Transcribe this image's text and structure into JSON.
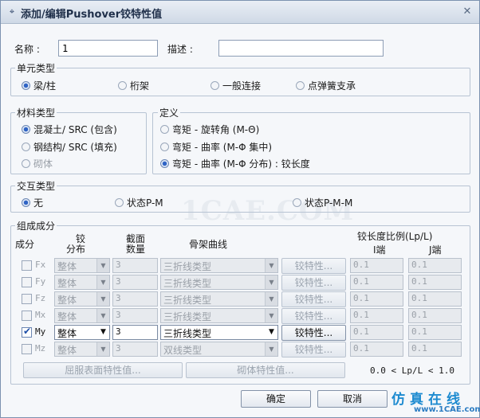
{
  "window": {
    "title": "添加/编辑Pushover铰特性值",
    "close_glyph": "✕",
    "title_glyph": "⌖"
  },
  "name": {
    "label": "名称 :",
    "value": "1"
  },
  "desc": {
    "label": "描述 :",
    "value": ""
  },
  "element_type": {
    "legend": "单元类型",
    "options": [
      {
        "label": "梁/柱",
        "selected": true
      },
      {
        "label": "桁架",
        "selected": false
      },
      {
        "label": "一般连接",
        "selected": false
      },
      {
        "label": "点弹簧支承",
        "selected": false
      }
    ]
  },
  "material_type": {
    "legend": "材料类型",
    "options": [
      {
        "label": "混凝土/ SRC (包含)",
        "selected": true
      },
      {
        "label": "钢结构/ SRC (填充)",
        "selected": false
      },
      {
        "label": "砌体",
        "selected": false
      }
    ]
  },
  "definition": {
    "legend": "定义",
    "options": [
      {
        "label": "弯矩 - 旋转角 (M-Θ)",
        "selected": false
      },
      {
        "label": "弯矩 - 曲率 (M-Φ 集中)",
        "selected": false
      },
      {
        "label": "弯矩 - 曲率 (M-Φ 分布) : 铰长度",
        "selected": true
      }
    ]
  },
  "interaction_type": {
    "legend": "交互类型",
    "options": [
      {
        "label": "无",
        "selected": true
      },
      {
        "label": "状态P-M",
        "selected": false
      },
      {
        "label": "状态P-M-M",
        "selected": false
      }
    ]
  },
  "components": {
    "legend": "组成成分",
    "headers": {
      "component": "成分",
      "hinge_dist_1": "铰",
      "hinge_dist_2": "分布",
      "section_count_1": "截面",
      "section_count_2": "数量",
      "skeleton": "骨架曲线",
      "ratio": "铰长度比例(Lp/L)",
      "i_end": "I端",
      "j_end": "J端"
    },
    "rows": [
      {
        "name": "Fx",
        "checked": false,
        "distribution": "整体",
        "count": "3",
        "curve": "三折线类型",
        "button": "铰特性...",
        "i": "0.1",
        "j": "0.1"
      },
      {
        "name": "Fy",
        "checked": false,
        "distribution": "整体",
        "count": "3",
        "curve": "三折线类型",
        "button": "铰特性...",
        "i": "0.1",
        "j": "0.1"
      },
      {
        "name": "Fz",
        "checked": false,
        "distribution": "整体",
        "count": "3",
        "curve": "三折线类型",
        "button": "铰特性...",
        "i": "0.1",
        "j": "0.1"
      },
      {
        "name": "Mx",
        "checked": false,
        "distribution": "整体",
        "count": "3",
        "curve": "三折线类型",
        "button": "铰特性...",
        "i": "0.1",
        "j": "0.1"
      },
      {
        "name": "My",
        "checked": true,
        "distribution": "整体",
        "count": "3",
        "curve": "三折线类型",
        "button": "铰特性...",
        "i": "0.1",
        "j": "0.1"
      },
      {
        "name": "Mz",
        "checked": false,
        "distribution": "整体",
        "count": "3",
        "curve": "双线类型",
        "button": "铰特性...",
        "i": "0.1",
        "j": "0.1"
      }
    ],
    "yield_surface_button": "屈服表面特性值...",
    "masonry_button": "砌体特性值...",
    "range_note": "0.0 < Lp/L < 1.0"
  },
  "footer": {
    "ok": "确定",
    "cancel": "取消"
  },
  "watermark": {
    "center": "1CAE.COM",
    "brand": "仿真在线",
    "url": "www.1CAE.com"
  }
}
